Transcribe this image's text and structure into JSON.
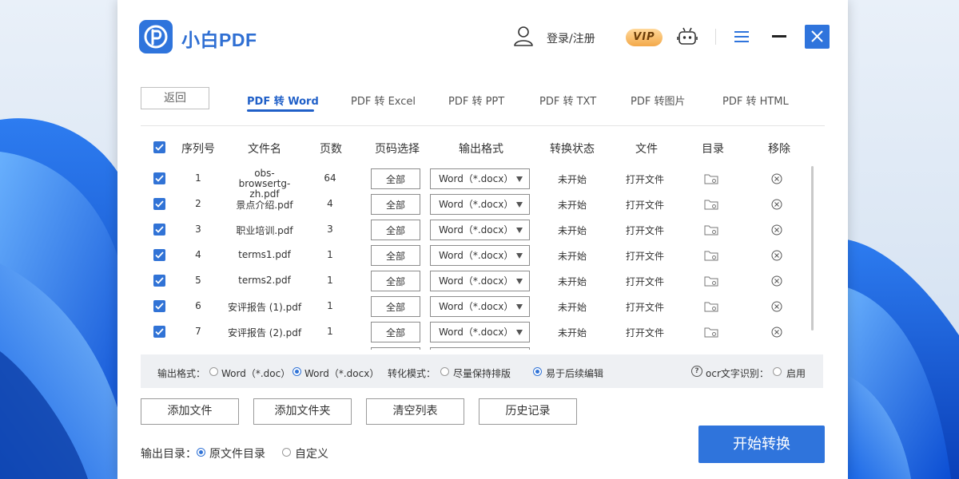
{
  "app": {
    "title": "小白PDF"
  },
  "header": {
    "login_label": "登录/注册",
    "vip_label": "VIP"
  },
  "colors": {
    "accent": "#2f74dc",
    "tab_active": "#1f5fc8"
  },
  "icons": [
    "app-logo-icon",
    "user-icon",
    "robot-icon",
    "menu-icon",
    "minimize-icon",
    "close-icon",
    "checkbox-icon",
    "folder-icon",
    "remove-icon",
    "help-icon"
  ],
  "nav": {
    "back_label": "返回",
    "tabs": [
      {
        "label": "PDF 转 Word",
        "active": true
      },
      {
        "label": "PDF 转 Excel",
        "active": false
      },
      {
        "label": "PDF 转 PPT",
        "active": false
      },
      {
        "label": "PDF 转 TXT",
        "active": false
      },
      {
        "label": "PDF 转图片",
        "active": false
      },
      {
        "label": "PDF 转 HTML",
        "active": false
      }
    ]
  },
  "table": {
    "headers": [
      "序列号",
      "文件名",
      "页数",
      "页码选择",
      "输出格式",
      "转换状态",
      "文件",
      "目录",
      "移除"
    ],
    "rows": [
      {
        "index": "1",
        "filename": "obs-browsertg-zh.pdf",
        "pages": "64",
        "page_select": "全部",
        "format": "Word（*.docx）",
        "status": "未开始",
        "file_action": "打开文件"
      },
      {
        "index": "2",
        "filename": "景点介绍.pdf",
        "pages": "4",
        "page_select": "全部",
        "format": "Word（*.docx）",
        "status": "未开始",
        "file_action": "打开文件"
      },
      {
        "index": "3",
        "filename": "职业培训.pdf",
        "pages": "3",
        "page_select": "全部",
        "format": "Word（*.docx）",
        "status": "未开始",
        "file_action": "打开文件"
      },
      {
        "index": "4",
        "filename": "terms1.pdf",
        "pages": "1",
        "page_select": "全部",
        "format": "Word（*.docx）",
        "status": "未开始",
        "file_action": "打开文件"
      },
      {
        "index": "5",
        "filename": "terms2.pdf",
        "pages": "1",
        "page_select": "全部",
        "format": "Word（*.docx）",
        "status": "未开始",
        "file_action": "打开文件"
      },
      {
        "index": "6",
        "filename": "安评报告 (1).pdf",
        "pages": "1",
        "page_select": "全部",
        "format": "Word（*.docx）",
        "status": "未开始",
        "file_action": "打开文件"
      },
      {
        "index": "7",
        "filename": "安评报告 (2).pdf",
        "pages": "1",
        "page_select": "全部",
        "format": "Word（*.docx）",
        "status": "未开始",
        "file_action": "打开文件"
      },
      {
        "index": "",
        "filename": "",
        "pages": "",
        "page_select": "",
        "format": "",
        "status": "",
        "file_action": ""
      }
    ]
  },
  "options": {
    "output_format_label": "输出格式：",
    "output_format_options": [
      {
        "label": "Word（*.doc）",
        "selected": false
      },
      {
        "label": "Word（*.docx）",
        "selected": true
      }
    ],
    "convert_mode_label": "转化模式：",
    "convert_mode_options": [
      {
        "label": "尽量保持排版",
        "selected": false
      },
      {
        "label": "易于后续编辑",
        "selected": true
      }
    ],
    "ocr_label": "ocr文字识别：",
    "ocr_option": {
      "label": "启用",
      "selected": false
    }
  },
  "actions": {
    "buttons": [
      "添加文件",
      "添加文件夹",
      "清空列表",
      "历史记录"
    ],
    "start_label": "开始转换"
  },
  "output_dir": {
    "label": "输出目录：",
    "options": [
      {
        "label": "原文件目录",
        "selected": true
      },
      {
        "label": "自定义",
        "selected": false
      }
    ]
  }
}
